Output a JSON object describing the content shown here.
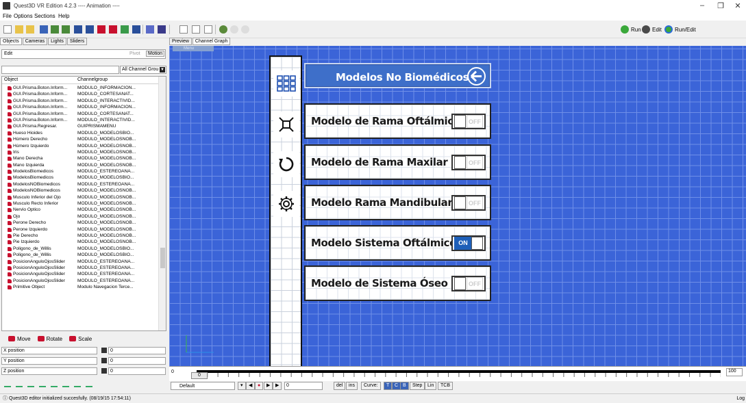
{
  "window": {
    "title": "Quest3D VR Edition 4.2.3     ---- Animation ----"
  },
  "menu": [
    "File",
    "Options",
    "Sections",
    "Help"
  ],
  "toolbar": {
    "run": "Run",
    "edit": "Edit",
    "run_edit": "Run/Edit"
  },
  "left_tabs": [
    "Objects",
    "Cameras",
    "Lights",
    "Sliders"
  ],
  "edit_row": {
    "label": "Edit",
    "pivot": "Pivot",
    "motion": "Motion"
  },
  "channel_filter": {
    "selected": "All Channel Grou"
  },
  "object_list": {
    "col_object": "Object",
    "col_group": "Channelgroup",
    "rows": [
      {
        "name": "GUI.Prisma.Boton.Inform...",
        "group": "MODULO_INFORMACION..."
      },
      {
        "name": "GUI.Prisma.Boton.Inform...",
        "group": "MODULO_CORTESANAT..."
      },
      {
        "name": "GUI.Prisma.Boton.Inform...",
        "group": "MODULO_INTERACTIVID..."
      },
      {
        "name": "GUI.Prisma.Boton.Inform...",
        "group": "MODULO_INFORMACION..."
      },
      {
        "name": "GUI.Prisma.Boton.Inform...",
        "group": "MODULO_CORTESANAT..."
      },
      {
        "name": "GUI.Prisma.Boton.Inform...",
        "group": "MODULO_INTERACTIVID..."
      },
      {
        "name": "GUI.Prisma.Regresar.",
        "group": "GUIPRISMAMENU"
      },
      {
        "name": "Hueso Hioides",
        "group": "MODULO_MODELOSBIO..."
      },
      {
        "name": "Húmero Derecho",
        "group": "MODULO_MODELOSNOB..."
      },
      {
        "name": "Húmero Izquierdo",
        "group": "MODULO_MODELOSNOB..."
      },
      {
        "name": "Iris",
        "group": "MODULO_MODELOSNOB..."
      },
      {
        "name": "Mano Derecha",
        "group": "MODULO_MODELOSNOB..."
      },
      {
        "name": "Mano Izquierda",
        "group": "MODULO_MODELOSNOB..."
      },
      {
        "name": "ModelosBiomedicos",
        "group": "MODULO_ESTEREOANA..."
      },
      {
        "name": "ModelosBiomedicos",
        "group": "MODULO_MODELOSBIO..."
      },
      {
        "name": "ModelosNOBiomedicos",
        "group": "MODULO_ESTEREOANA..."
      },
      {
        "name": "ModelosNOBiomedicos",
        "group": "MODULO_MODELOSNOB..."
      },
      {
        "name": "Musculo Inferior del Ojo",
        "group": "MODULO_MODELOSNOB..."
      },
      {
        "name": "Musculo Recto Inferior",
        "group": "MODULO_MODELOSNOB..."
      },
      {
        "name": "Nervio Optico",
        "group": "MODULO_MODELOSNOB..."
      },
      {
        "name": "Ojo",
        "group": "MODULO_MODELOSNOB..."
      },
      {
        "name": "Perone Derecho",
        "group": "MODULO_MODELOSNOB..."
      },
      {
        "name": "Perone Izquierdo",
        "group": "MODULO_MODELOSNOB..."
      },
      {
        "name": "Pie Derecho",
        "group": "MODULO_MODELOSNOB..."
      },
      {
        "name": "Pie Izquierdo",
        "group": "MODULO_MODELOSNOB..."
      },
      {
        "name": "Poligono_de_Willis",
        "group": "MODULO_MODELOSBIO..."
      },
      {
        "name": "Poligono_de_Willis",
        "group": "MODULO_MODELOSBIO..."
      },
      {
        "name": "PosicionAnguloOjosSlider",
        "group": "MODULO_ESTEREOANA..."
      },
      {
        "name": "PosicionAnguloOjosSlider",
        "group": "MODULO_ESTEREOANA..."
      },
      {
        "name": "PosicionAnguloOjosSlider",
        "group": "MODULO_ESTEREOANA..."
      },
      {
        "name": "PosicionAnguloOjosSlider",
        "group": "MODULO_ESTEREOANA..."
      },
      {
        "name": "Primitive Object",
        "group": "Modulo Navegacion Terce..."
      }
    ]
  },
  "transform": {
    "move": "Move",
    "rotate": "Rotate",
    "scale": "Scale",
    "x_label": "X position",
    "y_label": "Y position",
    "z_label": "Z position",
    "x_val": "0",
    "y_val": "0",
    "z_val": "0"
  },
  "right_tabs": [
    "Preview",
    "Channel Graph"
  ],
  "menu_strip": "Menu",
  "scene": {
    "header": "Modelos No Biomédicos",
    "panels": [
      {
        "label": "Modelo de Rama Oftálmica",
        "state": "OFF"
      },
      {
        "label": "Modelo de Rama Maxilar",
        "state": "OFF"
      },
      {
        "label": "Modelo Rama Mandibular",
        "state": "OFF"
      },
      {
        "label": "Modelo Sistema Oftálmico",
        "state": "ON"
      },
      {
        "label": "Modelo de Sistema Óseo",
        "state": "OFF"
      }
    ]
  },
  "timeline": {
    "start": "0",
    "thumb": "0",
    "end": "100"
  },
  "anim": {
    "preset": "Default",
    "frame": "0",
    "del": "del",
    "ins": "ins",
    "curve": "Curve:",
    "step": "Step",
    "lin": "Lin",
    "tcb": "TCB"
  },
  "status": {
    "message": "Quest3D editor initialized succesfully. (08/19/15 17:54:11)",
    "log": "Log"
  }
}
